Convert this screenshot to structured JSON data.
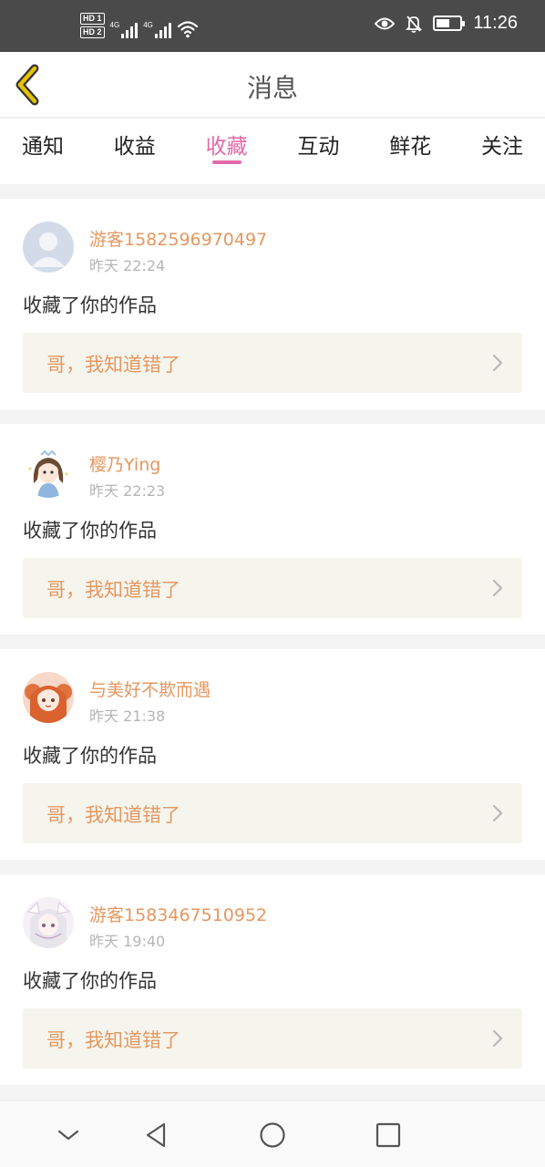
{
  "status_bar": {
    "time": "11:26",
    "sim_labels": [
      "HD 1",
      "HD 2"
    ],
    "network_labels": [
      "4G",
      "4G"
    ],
    "battery_level": 0.55,
    "icons": [
      "signal-icon",
      "wifi-icon",
      "eye-icon",
      "bell-off-icon",
      "battery-icon"
    ]
  },
  "header": {
    "title": "消息",
    "back_icon": "chevron-left-icon",
    "accent_color": "#e6c200"
  },
  "tabs": [
    {
      "label": "通知",
      "active": false
    },
    {
      "label": "收益",
      "active": false
    },
    {
      "label": "收藏",
      "active": true
    },
    {
      "label": "互动",
      "active": false
    },
    {
      "label": "鲜花",
      "active": false
    },
    {
      "label": "关注",
      "active": false
    }
  ],
  "colors": {
    "active_tab": "#e26aa9",
    "username": "#e6975f",
    "work_title": "#e6975f",
    "work_bg": "#f5f5ee"
  },
  "notifications": [
    {
      "username": "游客1582596970497",
      "time": "昨天 22:24",
      "action": "收藏了你的作品",
      "work_title": "哥，我知道错了",
      "avatar": "default-avatar"
    },
    {
      "username": "樱乃Ying",
      "time": "昨天 22:23",
      "action": "收藏了你的作品",
      "work_title": "哥，我知道错了",
      "avatar": "anime-girl-avatar"
    },
    {
      "username": "与美好不欺而遇",
      "time": "昨天 21:38",
      "action": "收藏了你的作品",
      "work_title": "哥，我知道错了",
      "avatar": "orange-hair-girl-avatar"
    },
    {
      "username": "游客1583467510952",
      "time": "昨天 19:40",
      "action": "收藏了你的作品",
      "work_title": "哥，我知道错了",
      "avatar": "white-hair-girl-avatar"
    }
  ],
  "nav_bar": {
    "icons": [
      "collapse-down-icon",
      "back-triangle-icon",
      "home-circle-icon",
      "recents-square-icon"
    ]
  }
}
